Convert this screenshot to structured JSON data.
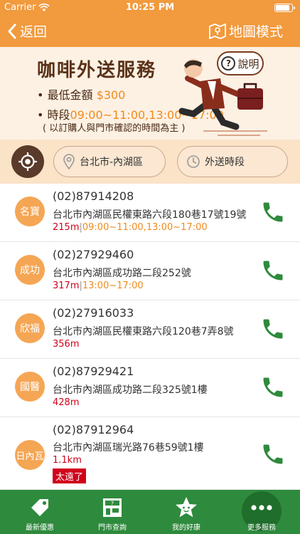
{
  "status_bar": {
    "carrier": "Carrier",
    "time": "10:25 PM",
    "battery_level": 0.95
  },
  "navbar": {
    "back_label": "返回",
    "map_mode_label": "地圖模式"
  },
  "banner": {
    "title": "咖啡外送服務",
    "help_label": "說明",
    "min_amount_label": "最低金額",
    "min_amount_value": "$300",
    "hours_label": "時段",
    "hours_value": "09:00~11:00,13:00~17:00",
    "note": "( 以訂購人與門市確認的時間為主 )"
  },
  "filters": {
    "area": "台北市-內湖區",
    "delivery_time": "外送時段"
  },
  "stores": [
    {
      "badge": "名寶",
      "phone": "(02)87914208",
      "address": "台北市內湖區民權東路六段180巷17號19號",
      "distance": "215m",
      "hours": "09:00~11:00,13:00~17:00",
      "too_far": ""
    },
    {
      "badge": "成功",
      "phone": "(02)27929460",
      "address": "台北市內湖區成功路二段252號",
      "distance": "317m",
      "hours": "13:00~17:00",
      "too_far": ""
    },
    {
      "badge": "欣福",
      "phone": "(02)27916033",
      "address": "台北市內湖區民權東路六段120巷7弄8號",
      "distance": "356m",
      "hours": "",
      "too_far": ""
    },
    {
      "badge": "國醫",
      "phone": "(02)87929421",
      "address": "台北市內湖區成功路二段325號1樓",
      "distance": "428m",
      "hours": "",
      "too_far": ""
    },
    {
      "badge": "日內瓦",
      "phone": "(02)87912964",
      "address": "台北市內湖區瑞光路76巷59號1樓",
      "distance": "1.1km",
      "hours": "",
      "too_far": "太遠了"
    }
  ],
  "tabs": [
    {
      "label": "最新優惠",
      "icon": "tag-icon"
    },
    {
      "label": "門市查詢",
      "icon": "store-icon"
    },
    {
      "label": "我的好康",
      "icon": "star-icon"
    },
    {
      "label": "更多服務",
      "icon": "more-icon"
    }
  ],
  "colors": {
    "primary": "#f19a3e",
    "tab_bar": "#2e8a3c",
    "call_icon": "#2e8a3c",
    "distance": "#d0021b",
    "hours": "#f08a1c"
  }
}
